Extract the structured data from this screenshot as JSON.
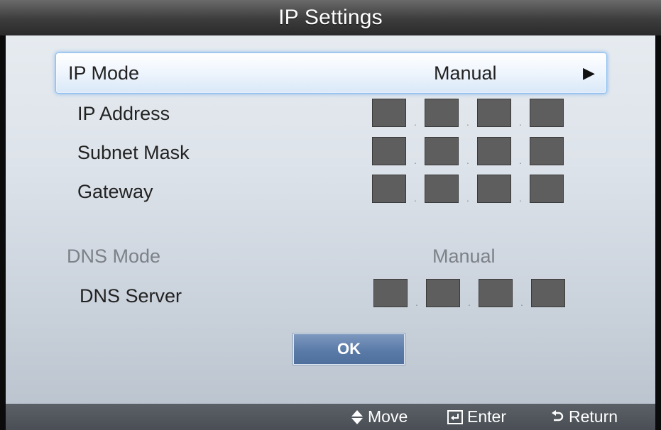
{
  "header": {
    "title": "IP Settings"
  },
  "ip_mode": {
    "label": "IP Mode",
    "value": "Manual"
  },
  "rows": {
    "ip_address": {
      "label": "IP Address"
    },
    "subnet_mask": {
      "label": "Subnet Mask"
    },
    "gateway": {
      "label": "Gateway"
    }
  },
  "dns_mode": {
    "label": "DNS Mode",
    "value": "Manual"
  },
  "dns_server": {
    "label": "DNS Server"
  },
  "buttons": {
    "ok_label": "OK"
  },
  "footer": {
    "move_label": "Move",
    "enter_label": "Enter",
    "return_label": "Return"
  },
  "icons": {
    "move": "up-down-icon",
    "enter": "enter-icon",
    "return": "return-icon",
    "arrow": "right-arrow-icon"
  },
  "colors": {
    "highlight_border": "#8ec0f0",
    "octet_fill": "#5e5e5e",
    "ok_button": "#5a7ba8"
  }
}
